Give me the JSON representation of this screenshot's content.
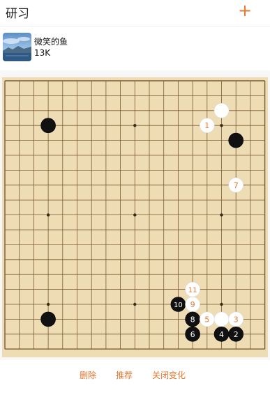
{
  "header": {
    "title": "研习",
    "add_icon": "+"
  },
  "user": {
    "name": "微笑的鱼",
    "rank": "13K"
  },
  "actions": {
    "delete": "删除",
    "recommend": "推荐",
    "close_variation": "关闭变化"
  },
  "colors": {
    "accent": "#e8772e",
    "board": "#eedcb4",
    "number_on_white": "#e8772e",
    "number_on_black": "#ffffff"
  },
  "board": {
    "size": 19,
    "star_points": [
      [
        3,
        3
      ],
      [
        9,
        3
      ],
      [
        15,
        3
      ],
      [
        3,
        9
      ],
      [
        9,
        9
      ],
      [
        15,
        9
      ],
      [
        3,
        15
      ],
      [
        9,
        15
      ],
      [
        15,
        15
      ]
    ],
    "stones": [
      {
        "color": "black",
        "col": 3,
        "row": 3,
        "label": ""
      },
      {
        "color": "black",
        "col": 3,
        "row": 16,
        "label": ""
      },
      {
        "color": "white",
        "col": 15,
        "row": 2,
        "label": ""
      },
      {
        "color": "white",
        "col": 14,
        "row": 3,
        "label": "1"
      },
      {
        "color": "black",
        "col": 16,
        "row": 4,
        "label": ""
      },
      {
        "color": "white",
        "col": 16,
        "row": 7,
        "label": "7"
      },
      {
        "color": "white",
        "col": 13,
        "row": 14,
        "label": "11"
      },
      {
        "color": "black",
        "col": 12,
        "row": 15,
        "label": "10"
      },
      {
        "color": "white",
        "col": 13,
        "row": 15,
        "label": "9"
      },
      {
        "color": "black",
        "col": 13,
        "row": 16,
        "label": "8"
      },
      {
        "color": "white",
        "col": 14,
        "row": 16,
        "label": "5"
      },
      {
        "color": "white",
        "col": 15,
        "row": 16,
        "label": ""
      },
      {
        "color": "white",
        "col": 16,
        "row": 16,
        "label": "3"
      },
      {
        "color": "black",
        "col": 13,
        "row": 17,
        "label": "6"
      },
      {
        "color": "black",
        "col": 15,
        "row": 17,
        "label": "4"
      },
      {
        "color": "black",
        "col": 16,
        "row": 17,
        "label": "2"
      }
    ]
  }
}
